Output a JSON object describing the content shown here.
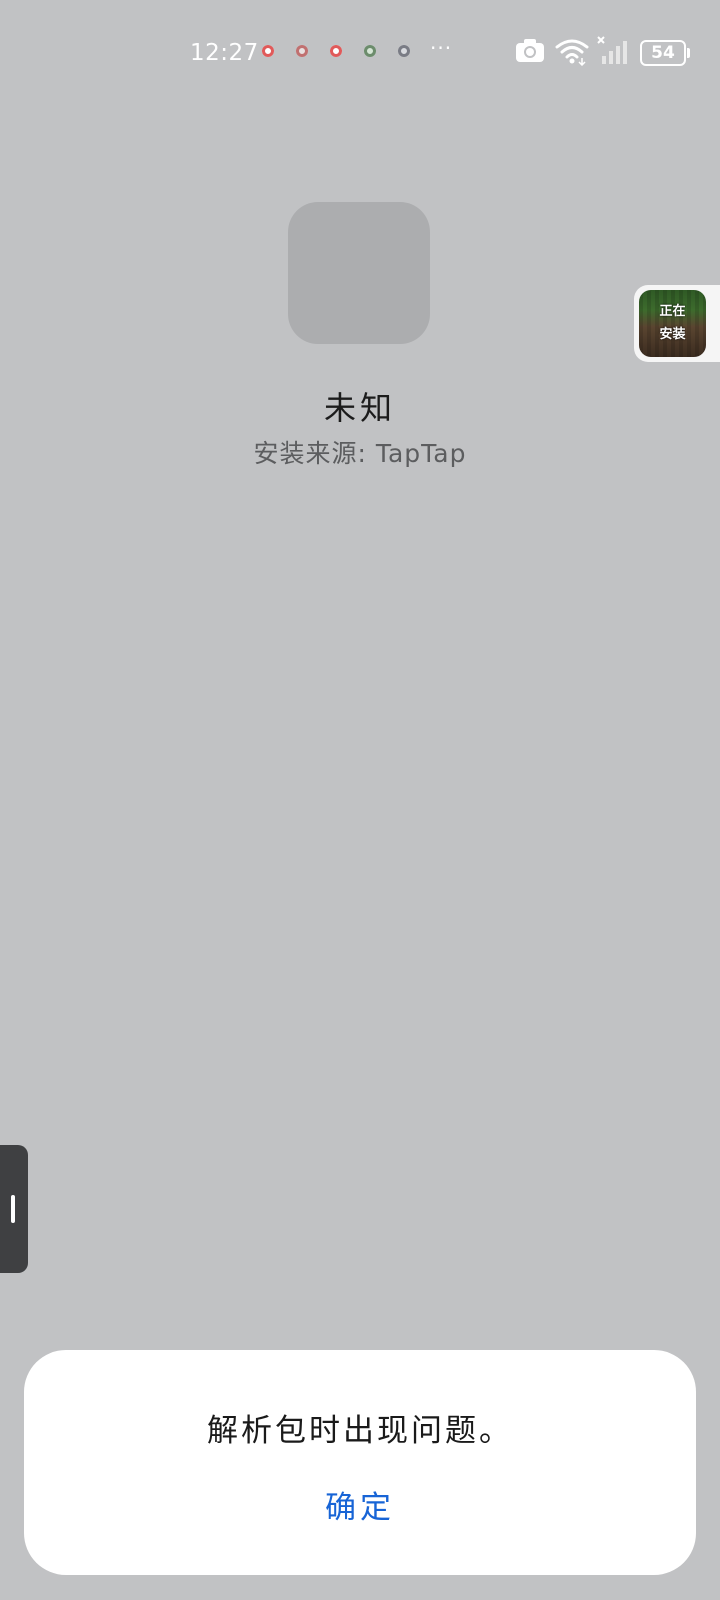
{
  "status_bar": {
    "time": "12:27",
    "more_dots": "···",
    "battery": "54",
    "notification_icons": [
      "red-record-icon",
      "app-notif-icon",
      "red-record-icon",
      "green-app-icon",
      "gray-app-icon"
    ],
    "icons": [
      "camera-icon",
      "wifi-icon",
      "signal-icon",
      "battery-icon"
    ]
  },
  "app": {
    "name": "未知",
    "source": "安装来源: TapTap"
  },
  "installing_widget": {
    "line1": "正在",
    "line2": "安装"
  },
  "dialog": {
    "message": "解析包时出现问题。",
    "confirm": "确定"
  },
  "colors": {
    "background": "#c1c2c4",
    "dialog_bg": "#ffffff",
    "accent": "#1764d6"
  }
}
